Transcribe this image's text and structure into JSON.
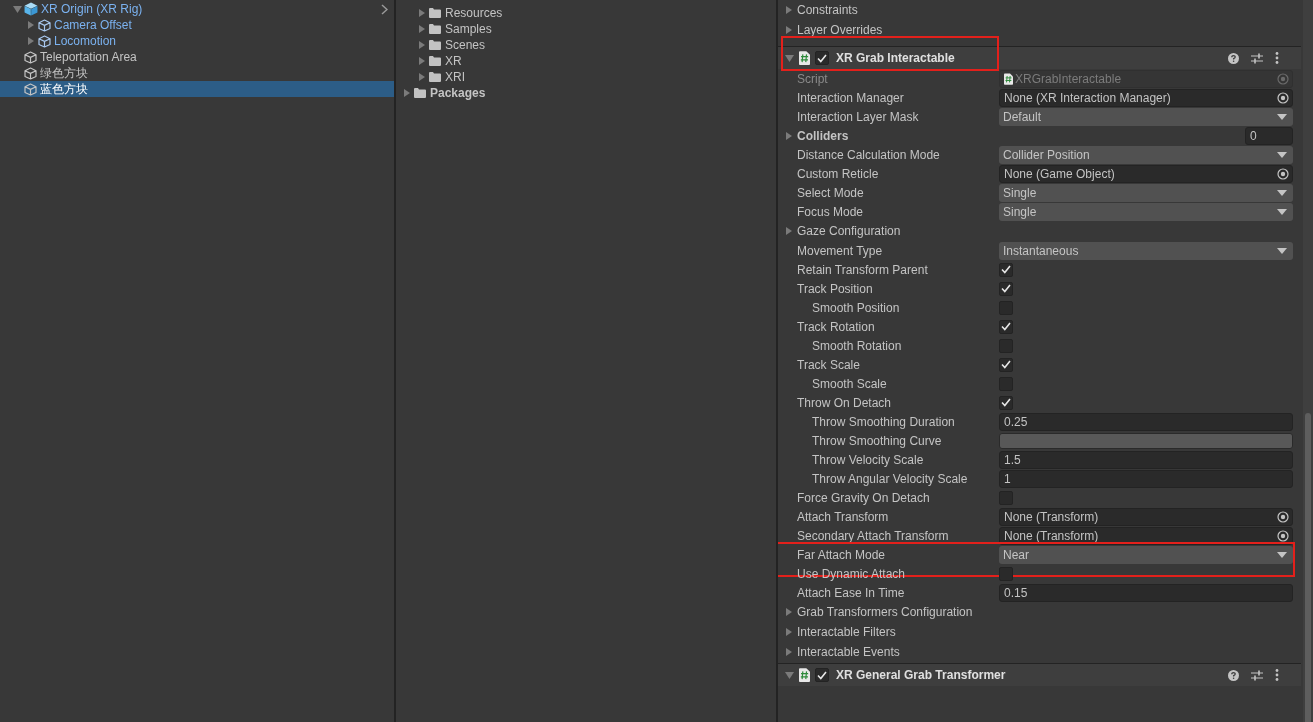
{
  "hierarchy": {
    "items": [
      {
        "label": "XR Origin (XR Rig)",
        "kind": "prefab-root",
        "expanded": true,
        "selected": false,
        "children": [
          {
            "label": "Camera Offset",
            "kind": "prefab",
            "expanded": false,
            "selected": false
          },
          {
            "label": "Locomotion",
            "kind": "prefab",
            "expanded": false,
            "selected": false
          }
        ]
      },
      {
        "label": "Teleportation Area",
        "kind": "object",
        "selected": false
      },
      {
        "label": "绿色方块",
        "kind": "object",
        "selected": false
      },
      {
        "label": "蓝色方块",
        "kind": "object",
        "selected": true
      }
    ]
  },
  "project": {
    "folders": [
      {
        "label": "Resources",
        "expanded": false
      },
      {
        "label": "Samples",
        "expanded": false
      },
      {
        "label": "Scenes",
        "expanded": false
      },
      {
        "label": "XR",
        "expanded": false
      },
      {
        "label": "XRI",
        "expanded": false
      }
    ],
    "root_folders": [
      {
        "label": "Packages",
        "expanded": false
      }
    ]
  },
  "inspector": {
    "sections": [
      {
        "label": "Constraints",
        "expanded": false
      },
      {
        "label": "Layer Overrides",
        "expanded": false
      }
    ],
    "component": {
      "title": "XR Grab Interactable",
      "enabled": true,
      "expanded": true,
      "highlighted": true,
      "properties": [
        {
          "label": "Script",
          "kind": "script",
          "value": "XRGrabInteractable",
          "highlighted": false
        },
        {
          "label": "Interaction Manager",
          "kind": "object",
          "value": "None (XR Interaction Manager)",
          "highlighted": false
        },
        {
          "label": "Interaction Layer Mask",
          "kind": "dropdown",
          "value": "Default",
          "highlighted": false
        },
        {
          "label": "Colliders",
          "kind": "list",
          "value": "0",
          "highlighted": false
        },
        {
          "label": "Distance Calculation Mode",
          "kind": "dropdown",
          "value": "Collider Position",
          "highlighted": false
        },
        {
          "label": "Custom Reticle",
          "kind": "object",
          "value": "None (Game Object)",
          "highlighted": false
        },
        {
          "label": "Select Mode",
          "kind": "dropdown",
          "value": "Single",
          "highlighted": false
        },
        {
          "label": "Focus Mode",
          "kind": "dropdown",
          "value": "Single",
          "highlighted": false
        },
        {
          "label": "Gaze Configuration",
          "kind": "foldout",
          "highlighted": false
        },
        {
          "label": "Movement Type",
          "kind": "dropdown",
          "value": "Instantaneous",
          "highlighted": false
        },
        {
          "label": "Retain Transform Parent",
          "kind": "checkbox",
          "checked": true,
          "highlighted": false
        },
        {
          "label": "Track Position",
          "kind": "checkbox",
          "checked": true,
          "highlighted": false,
          "children": [
            {
              "label": "Smooth Position",
              "kind": "checkbox",
              "checked": false,
              "highlighted": false
            }
          ]
        },
        {
          "label": "Track Rotation",
          "kind": "checkbox",
          "checked": true,
          "highlighted": false,
          "children": [
            {
              "label": "Smooth Rotation",
              "kind": "checkbox",
              "checked": false,
              "highlighted": false
            }
          ]
        },
        {
          "label": "Track Scale",
          "kind": "checkbox",
          "checked": true,
          "highlighted": false,
          "children": [
            {
              "label": "Smooth Scale",
              "kind": "checkbox",
              "checked": false,
              "highlighted": false
            }
          ]
        },
        {
          "label": "Throw On Detach",
          "kind": "checkbox",
          "checked": true,
          "highlighted": false,
          "children": [
            {
              "label": "Throw Smoothing Duration",
              "kind": "number",
              "value": "0.25",
              "highlighted": false
            },
            {
              "label": "Throw Smoothing Curve",
              "kind": "curve",
              "highlighted": false
            },
            {
              "label": "Throw Velocity Scale",
              "kind": "number",
              "value": "1.5",
              "highlighted": false
            },
            {
              "label": "Throw Angular Velocity Scale",
              "kind": "number",
              "value": "1",
              "highlighted": false
            }
          ]
        },
        {
          "label": "Force Gravity On Detach",
          "kind": "checkbox",
          "checked": false,
          "highlighted": false
        },
        {
          "label": "Attach Transform",
          "kind": "object",
          "value": "None (Transform)",
          "highlighted": false
        },
        {
          "label": "Secondary Attach Transform",
          "kind": "object",
          "value": "None (Transform)",
          "highlighted": false
        },
        {
          "label": "Far Attach Mode",
          "kind": "dropdown",
          "value": "Near",
          "highlighted": true
        },
        {
          "label": "Use Dynamic Attach",
          "kind": "checkbox",
          "checked": false,
          "highlighted": false
        },
        {
          "label": "Attach Ease In Time",
          "kind": "number",
          "value": "0.15",
          "highlighted": false
        },
        {
          "label": "Grab Transformers Configuration",
          "kind": "foldout",
          "highlighted": false
        },
        {
          "label": "Interactable Filters",
          "kind": "foldout",
          "highlighted": false
        },
        {
          "label": "Interactable Events",
          "kind": "foldout",
          "highlighted": false
        }
      ]
    },
    "next_component": {
      "title": "XR General Grab Transformer",
      "enabled": true,
      "expanded": true
    }
  }
}
